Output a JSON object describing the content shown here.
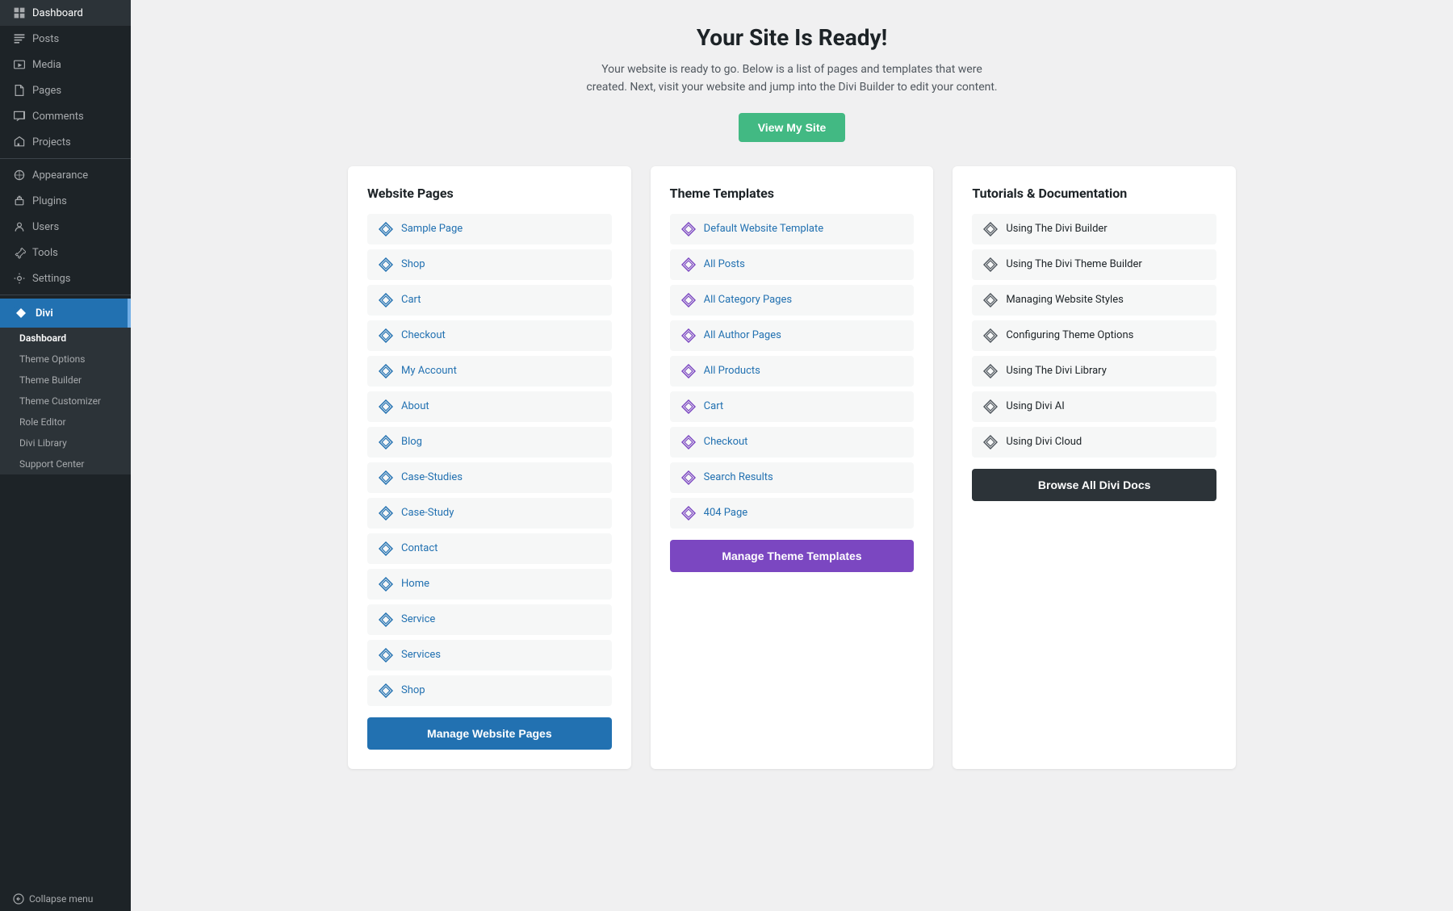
{
  "sidebar": {
    "logo": "Dashboard",
    "items": [
      {
        "label": "Dashboard",
        "icon": "dashboard",
        "active": false
      },
      {
        "label": "Posts",
        "icon": "posts",
        "active": false
      },
      {
        "label": "Media",
        "icon": "media",
        "active": false
      },
      {
        "label": "Pages",
        "icon": "pages",
        "active": false
      },
      {
        "label": "Comments",
        "icon": "comments",
        "active": false
      },
      {
        "label": "Projects",
        "icon": "projects",
        "active": false
      }
    ],
    "appearance": {
      "label": "Appearance",
      "icon": "appearance"
    },
    "plugins": {
      "label": "Plugins",
      "icon": "plugins"
    },
    "users": {
      "label": "Users",
      "icon": "users"
    },
    "tools": {
      "label": "Tools",
      "icon": "tools"
    },
    "settings": {
      "label": "Settings",
      "icon": "settings"
    },
    "divi": {
      "label": "Divi",
      "sub_items": [
        {
          "label": "Dashboard",
          "active": true
        },
        {
          "label": "Theme Options",
          "active": false
        },
        {
          "label": "Theme Builder",
          "active": false
        },
        {
          "label": "Theme Customizer",
          "active": false
        },
        {
          "label": "Role Editor",
          "active": false
        },
        {
          "label": "Divi Library",
          "active": false
        },
        {
          "label": "Support Center",
          "active": false
        }
      ]
    },
    "collapse": "Collapse menu"
  },
  "main": {
    "title": "Your Site Is Ready!",
    "subtitle": "Your website is ready to go. Below is a list of pages and templates that were created. Next, visit your website and jump into the Divi Builder to edit your content.",
    "view_site_btn": "View My Site",
    "cards": {
      "website_pages": {
        "title": "Website Pages",
        "items": [
          "Sample Page",
          "Shop",
          "Cart",
          "Checkout",
          "My Account",
          "About",
          "Blog",
          "Case-Studies",
          "Case-Study",
          "Contact",
          "Home",
          "Service",
          "Services",
          "Shop"
        ],
        "manage_btn": "Manage Website Pages"
      },
      "theme_templates": {
        "title": "Theme Templates",
        "items": [
          "Default Website Template",
          "All Posts",
          "All Category Pages",
          "All Author Pages",
          "All Products",
          "Cart",
          "Checkout",
          "Search Results",
          "404 Page"
        ],
        "manage_btn": "Manage Theme Templates"
      },
      "tutorials": {
        "title": "Tutorials & Documentation",
        "items": [
          "Using The Divi Builder",
          "Using The Divi Theme Builder",
          "Managing Website Styles",
          "Configuring Theme Options",
          "Using The Divi Library",
          "Using Divi AI",
          "Using Divi Cloud"
        ],
        "browse_btn": "Browse All Divi Docs"
      }
    }
  }
}
